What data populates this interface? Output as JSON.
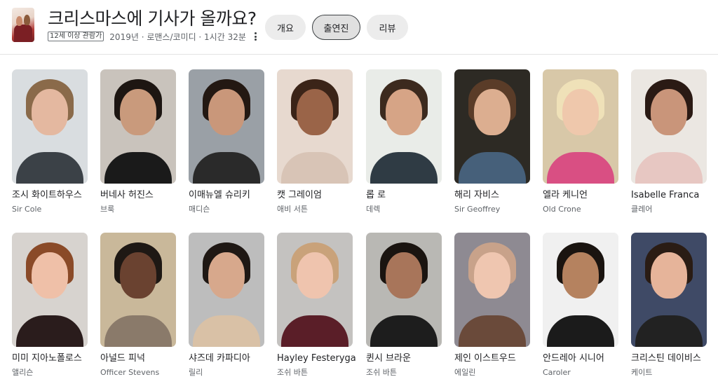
{
  "header": {
    "title": "크리스마스에 기사가 올까요?",
    "rating_badge": "12세 이상 관람가",
    "meta_text": "2019년 · 로맨스/코미디 · 1시간 32분",
    "tabs": [
      {
        "label": "개요",
        "active": false
      },
      {
        "label": "출연진",
        "active": true
      },
      {
        "label": "리뷰",
        "active": false
      }
    ]
  },
  "cast": [
    {
      "name": "조시 화이트하우스",
      "role": "Sir Cole",
      "colors": {
        "bg": "#d9dde0",
        "skin": "#e4b8a0",
        "hair": "#8a6a4a",
        "body": "#3b4147"
      }
    },
    {
      "name": "버네사 허진스",
      "role": "브룩",
      "colors": {
        "bg": "#c9c3bc",
        "skin": "#c99a7c",
        "hair": "#1d1612",
        "body": "#1a1a1a"
      }
    },
    {
      "name": "이매뉴엘 슈리키",
      "role": "매디슨",
      "colors": {
        "bg": "#9aa0a6",
        "skin": "#c9977a",
        "hair": "#231812",
        "body": "#2a2a2a"
      }
    },
    {
      "name": "캣 그레이엄",
      "role": "애비 서튼",
      "colors": {
        "bg": "#e7d9cf",
        "skin": "#9a6448",
        "hair": "#3b2418",
        "body": "#d8c4b6"
      }
    },
    {
      "name": "롭 로",
      "role": "데렉",
      "colors": {
        "bg": "#e9ece8",
        "skin": "#d6a486",
        "hair": "#3c2a1e",
        "body": "#2f3b44"
      }
    },
    {
      "name": "해리 자비스",
      "role": "Sir Geoffrey",
      "colors": {
        "bg": "#2d2a24",
        "skin": "#dcae90",
        "hair": "#5a3c28",
        "body": "#46607a"
      }
    },
    {
      "name": "엘라 케니언",
      "role": "Old Crone",
      "colors": {
        "bg": "#d8c8a8",
        "skin": "#efc8ac",
        "hair": "#efe1b8",
        "body": "#d94f83"
      }
    },
    {
      "name": "Isabelle Franca",
      "role": "클레어",
      "colors": {
        "bg": "#ebe7e2",
        "skin": "#c9957a",
        "hair": "#2a1a14",
        "body": "#e7c7c2"
      }
    },
    {
      "name": "미미 지아노폴로스",
      "role": "앨리슨",
      "colors": {
        "bg": "#d7d3cf",
        "skin": "#efc0a8",
        "hair": "#8a4a28",
        "body": "#2a1c1c"
      }
    },
    {
      "name": "아널드 피넉",
      "role": "Officer Stevens",
      "colors": {
        "bg": "#c9b89a",
        "skin": "#6a4230",
        "hair": "#1e1814",
        "body": "#8a7a6a"
      }
    },
    {
      "name": "샤즈데 카파디아",
      "role": "릴리",
      "colors": {
        "bg": "#bdbdbd",
        "skin": "#d7a88c",
        "hair": "#1f1814",
        "body": "#d9c1a6"
      }
    },
    {
      "name": "Hayley Festeryga",
      "role": "조쉬 바튼",
      "colors": {
        "bg": "#c4c2c0",
        "skin": "#efc4ae",
        "hair": "#c9a27a",
        "body": "#5a1e28"
      }
    },
    {
      "name": "퀸시 브라운",
      "role": "조쉬 바튼",
      "colors": {
        "bg": "#b9b8b4",
        "skin": "#a8755a",
        "hair": "#1a1410",
        "body": "#1d1d1d"
      }
    },
    {
      "name": "제인 이스트우드",
      "role": "에일린",
      "colors": {
        "bg": "#8e8a92",
        "skin": "#efc6b0",
        "hair": "#c8a28a",
        "body": "#6a4a3a"
      }
    },
    {
      "name": "안드레아 시니어",
      "role": "Caroler",
      "colors": {
        "bg": "#f0f0f0",
        "skin": "#b5825f",
        "hair": "#1a1410",
        "body": "#1b1b1b"
      }
    },
    {
      "name": "크리스틴 데이비스",
      "role": "케이트",
      "colors": {
        "bg": "#3f4a66",
        "skin": "#e6b49a",
        "hair": "#2a1c14",
        "body": "#222222"
      }
    }
  ]
}
